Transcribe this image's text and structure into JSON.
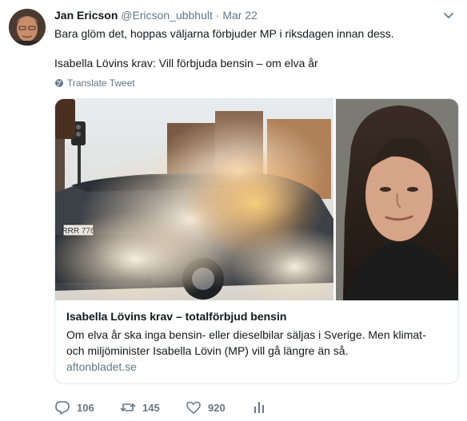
{
  "tweet": {
    "author_name": "Jan Ericson",
    "author_handle": "@Ericson_ubbhult",
    "separator": "·",
    "date": "Mar 22",
    "text_line1": "Bara glöm det, hoppas väljarna förbjuder MP i riksdagen innan dess.",
    "text_line2": "Isabella Lövins krav: Vill förbjuda bensin – om elva år",
    "translate_label": "Translate Tweet"
  },
  "card": {
    "title": "Isabella Lövins krav – totalförbjud bensin",
    "description": "Om elva år ska inga bensin- eller dieselbilar säljas i Sverige. Men klimat- och miljöminister Isabella Lövin (MP) vill gå längre än så.",
    "domain": "aftonbladet.se",
    "license_plate": "RRR 776"
  },
  "actions": {
    "reply_count": "106",
    "retweet_count": "145",
    "like_count": "920"
  },
  "icons": [
    "avatar",
    "chevron-down-icon",
    "globe-icon",
    "reply-icon",
    "retweet-icon",
    "like-icon",
    "analytics-icon"
  ],
  "colors": {
    "text": "#14171a",
    "muted": "#657786",
    "border": "#e1e8ed"
  }
}
